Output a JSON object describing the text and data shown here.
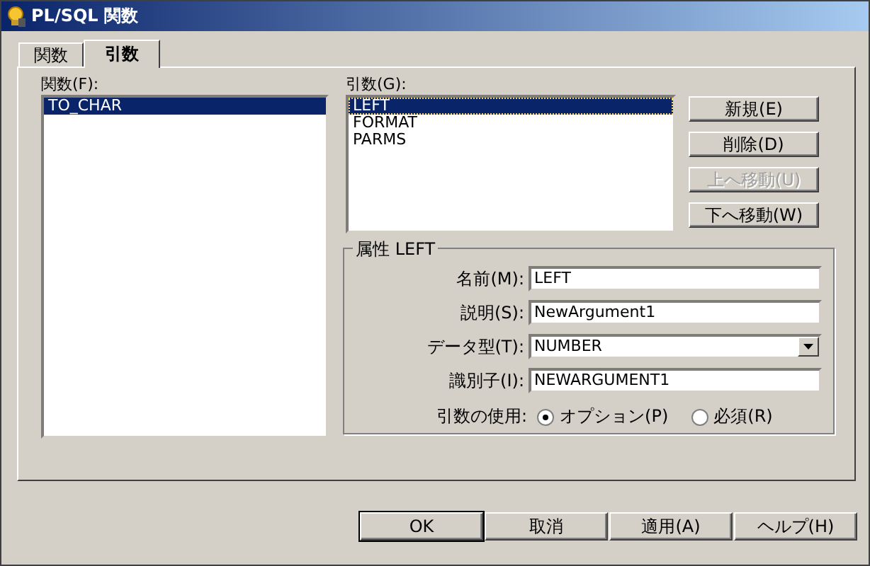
{
  "window": {
    "title": "PL/SQL 関数"
  },
  "tabs": [
    {
      "label": "関数",
      "selected": false
    },
    {
      "label": "引数",
      "selected": true
    }
  ],
  "functions": {
    "label": "関数(F):",
    "items": [
      {
        "label": "TO_CHAR",
        "selected": true
      }
    ]
  },
  "arguments": {
    "label": "引数(G):",
    "items": [
      {
        "label": "LEFT",
        "selected": true
      },
      {
        "label": "FORMAT",
        "selected": false
      },
      {
        "label": "PARMS",
        "selected": false
      }
    ]
  },
  "argument_buttons": [
    {
      "label": "新規(E)",
      "disabled": false
    },
    {
      "label": "削除(D)",
      "disabled": false
    },
    {
      "label": "上へ移動(U)",
      "disabled": true
    },
    {
      "label": "下へ移動(W)",
      "disabled": false
    }
  ],
  "properties": {
    "title": "属性 LEFT",
    "fields": [
      {
        "kind": "text",
        "label": "名前(M):",
        "value": "LEFT"
      },
      {
        "kind": "text",
        "label": "説明(S):",
        "value": "NewArgument1"
      },
      {
        "kind": "dropdown",
        "label": "データ型(T):",
        "value": "NUMBER"
      },
      {
        "kind": "text",
        "label": "識別子(I):",
        "value": "NEWARGUMENT1"
      }
    ],
    "usage": {
      "label": "引数の使用:",
      "options": [
        {
          "label": "オプション(P)",
          "selected": true
        },
        {
          "label": "必須(R)",
          "selected": false
        }
      ]
    }
  },
  "buttons": [
    {
      "label": "OK",
      "default": true
    },
    {
      "label": "取消",
      "default": false
    },
    {
      "label": "適用(A)",
      "default": false
    },
    {
      "label": "ヘルプ(H)",
      "default": false
    }
  ]
}
